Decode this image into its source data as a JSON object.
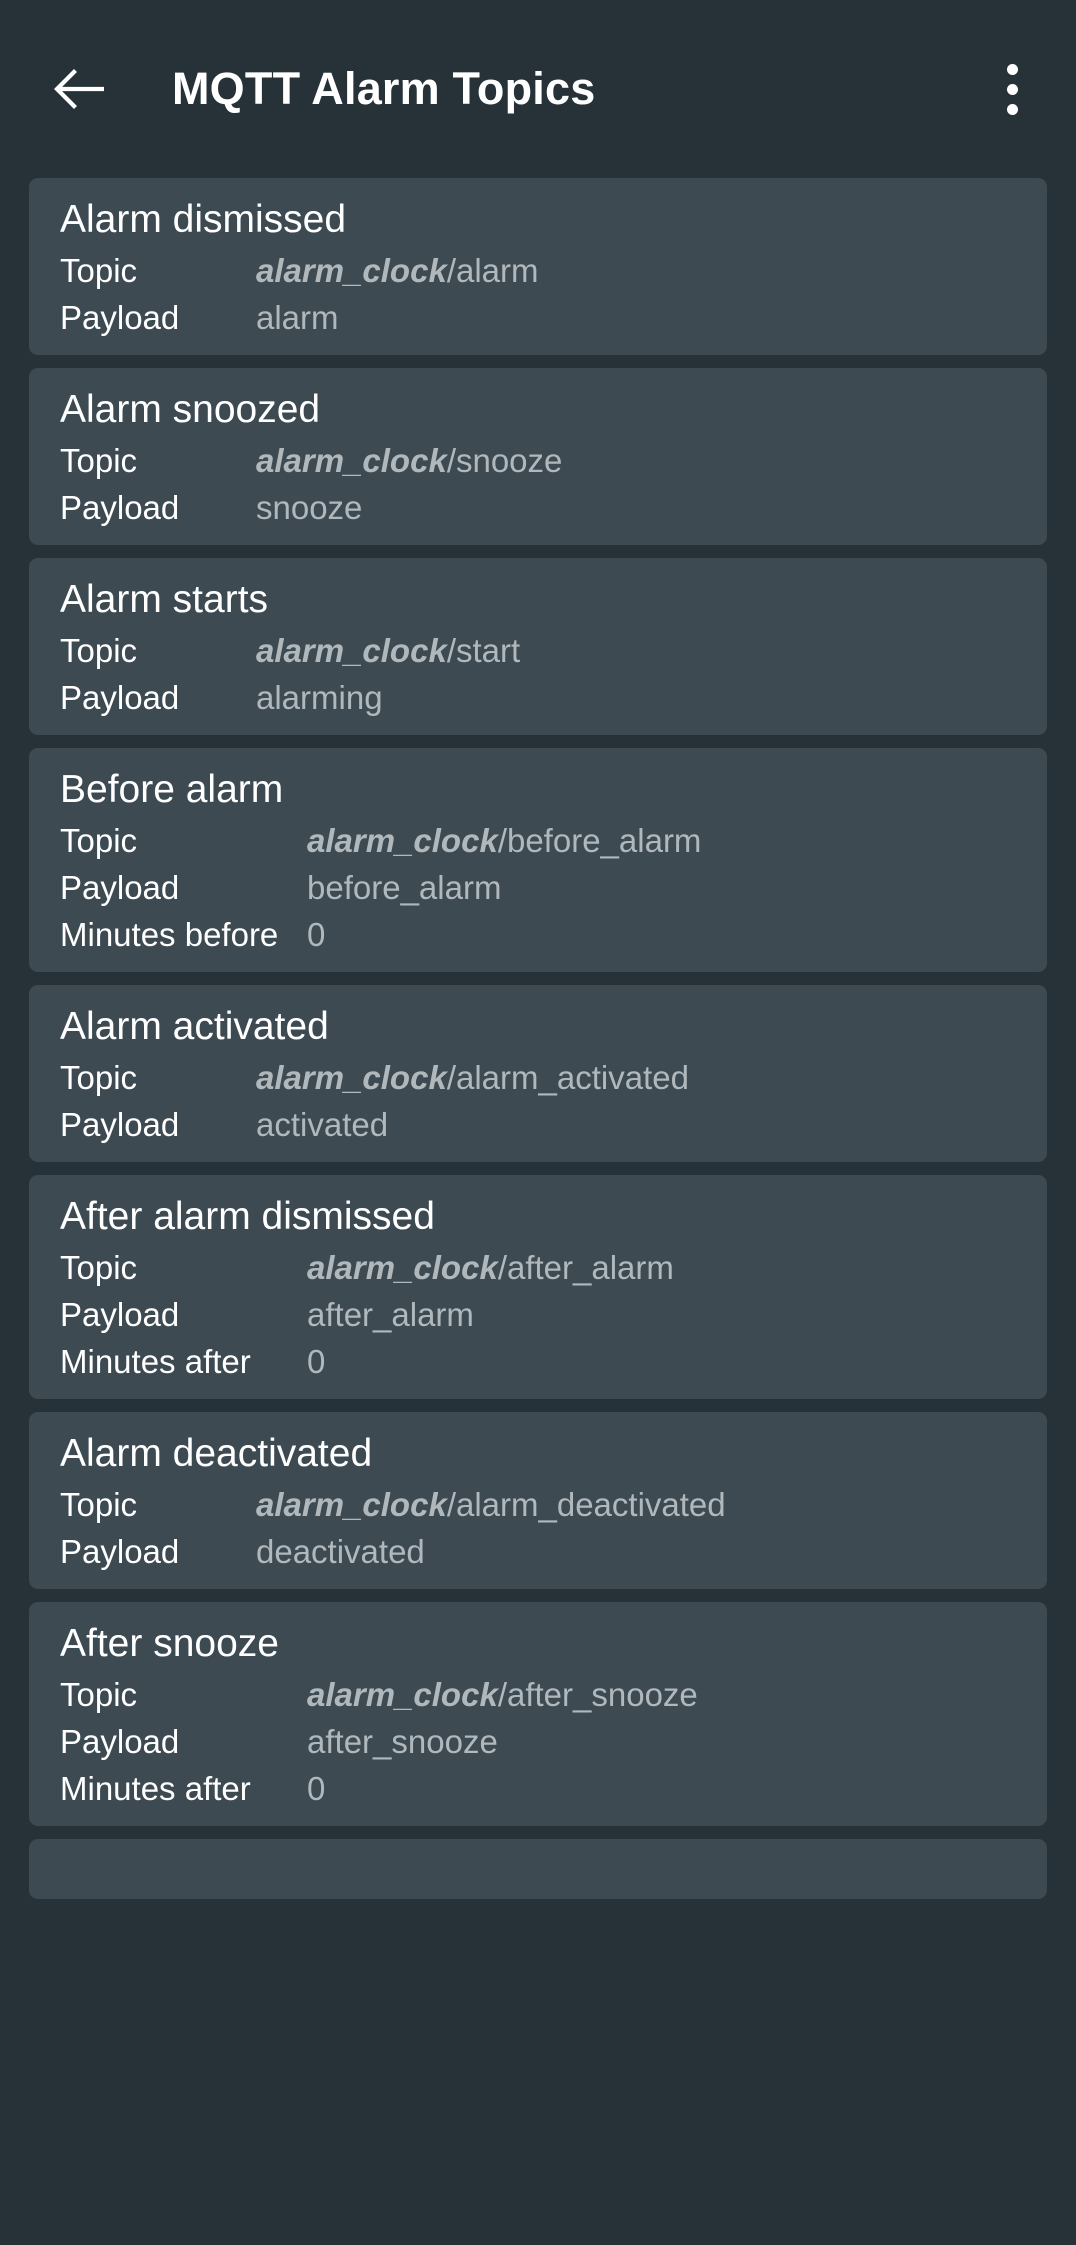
{
  "appbar": {
    "title": "MQTT Alarm Topics",
    "back_icon": "arrow-left-icon",
    "overflow_icon": "more-vertical-icon"
  },
  "labels": {
    "topic": "Topic",
    "payload": "Payload",
    "minutes_before": "Minutes before",
    "minutes_after": "Minutes after"
  },
  "colors": {
    "page_background": "#263238",
    "card_background": "#3d4a52",
    "title_text": "#ffffff",
    "label_text": "#ffffff",
    "value_text": "#b0b8bc"
  },
  "topic_prefix": "alarm_clock",
  "cards": [
    {
      "title": "Alarm dismissed",
      "rows": [
        {
          "label": "Topic",
          "prefix": "alarm_clock",
          "value": "/alarm"
        },
        {
          "label": "Payload",
          "prefix": "",
          "value": "alarm"
        }
      ]
    },
    {
      "title": "Alarm snoozed",
      "rows": [
        {
          "label": "Topic",
          "prefix": "alarm_clock",
          "value": "/snooze"
        },
        {
          "label": "Payload",
          "prefix": "",
          "value": "snooze"
        }
      ]
    },
    {
      "title": "Alarm starts",
      "rows": [
        {
          "label": "Topic",
          "prefix": "alarm_clock",
          "value": "/start"
        },
        {
          "label": "Payload",
          "prefix": "",
          "value": "alarming"
        }
      ]
    },
    {
      "title": "Before alarm",
      "rows": [
        {
          "label": "Topic",
          "prefix": "alarm_clock",
          "value": "/before_alarm"
        },
        {
          "label": "Payload",
          "prefix": "",
          "value": "before_alarm"
        },
        {
          "label": "Minutes before",
          "prefix": "",
          "value": "0"
        }
      ]
    },
    {
      "title": "Alarm activated",
      "rows": [
        {
          "label": "Topic",
          "prefix": "alarm_clock",
          "value": "/alarm_activated"
        },
        {
          "label": "Payload",
          "prefix": "",
          "value": "activated"
        }
      ]
    },
    {
      "title": "After alarm dismissed",
      "rows": [
        {
          "label": "Topic",
          "prefix": "alarm_clock",
          "value": "/after_alarm"
        },
        {
          "label": "Payload",
          "prefix": "",
          "value": "after_alarm"
        },
        {
          "label": "Minutes after",
          "prefix": "",
          "value": "0"
        }
      ]
    },
    {
      "title": "Alarm deactivated",
      "rows": [
        {
          "label": "Topic",
          "prefix": "alarm_clock",
          "value": "/alarm_deactivated"
        },
        {
          "label": "Payload",
          "prefix": "",
          "value": "deactivated"
        }
      ]
    },
    {
      "title": "After snooze",
      "rows": [
        {
          "label": "Topic",
          "prefix": "alarm_clock",
          "value": "/after_snooze"
        },
        {
          "label": "Payload",
          "prefix": "",
          "value": "after_snooze"
        },
        {
          "label": "Minutes after",
          "prefix": "",
          "value": "0"
        }
      ]
    },
    {
      "title": "",
      "rows": [],
      "partial": true
    }
  ]
}
